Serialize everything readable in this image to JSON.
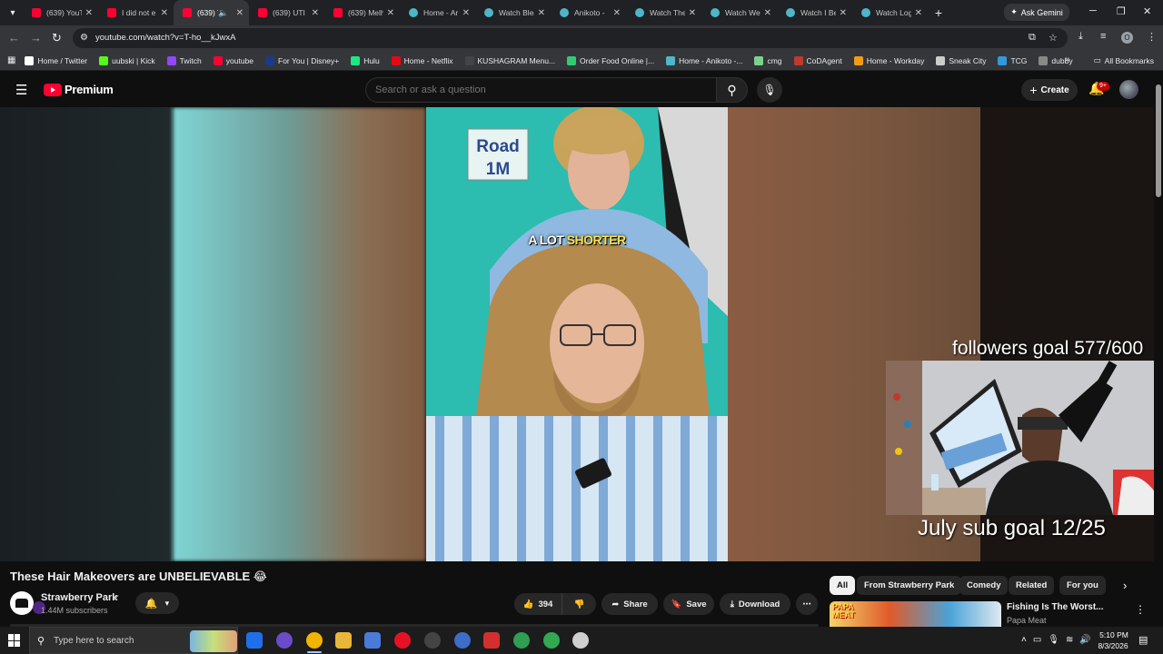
{
  "browser": {
    "tabs": [
      {
        "label": "(639) YouT",
        "icon": "youtube-icon",
        "active": false
      },
      {
        "label": "I did not e",
        "icon": "youtube-icon",
        "active": false
      },
      {
        "label": "(639) T",
        "icon": "youtube-icon",
        "active": true,
        "audio": true
      },
      {
        "label": "(639) UTI I",
        "icon": "youtube-icon",
        "active": false
      },
      {
        "label": "(639) Melh",
        "icon": "youtube-icon",
        "active": false
      },
      {
        "label": "Home - Ar",
        "icon": "globe-icon",
        "active": false
      },
      {
        "label": "Watch Blea",
        "icon": "globe-icon",
        "active": false
      },
      {
        "label": "Anikoto -",
        "icon": "globe-icon",
        "active": false
      },
      {
        "label": "Watch The",
        "icon": "globe-icon",
        "active": false
      },
      {
        "label": "Watch We",
        "icon": "globe-icon",
        "active": false
      },
      {
        "label": "Watch I Be",
        "icon": "globe-icon",
        "active": false
      },
      {
        "label": "Watch Log",
        "icon": "globe-icon",
        "active": false
      }
    ],
    "ask_gemini": "Ask Gemini",
    "url": "youtube.com/watch?v=T-ho__kJwxA",
    "bookmarks": [
      {
        "label": "Home / Twitter",
        "color": "#ffffff"
      },
      {
        "label": "uubski | Kick",
        "color": "#53fc18"
      },
      {
        "label": "Twitch",
        "color": "#9146ff"
      },
      {
        "label": "youtube",
        "color": "#ff0033"
      },
      {
        "label": "For You | Disney+",
        "color": "#1a3a8a"
      },
      {
        "label": "Hulu",
        "color": "#1ce783"
      },
      {
        "label": "Home - Netflix",
        "color": "#e50914"
      },
      {
        "label": "KUSHAGRAM Menu...",
        "color": "#444444"
      },
      {
        "label": "Order Food Online |...",
        "color": "#2ecc71"
      },
      {
        "label": "Home - Anikoto -...",
        "color": "#4fb5c9"
      },
      {
        "label": "cmg",
        "color": "#7bd389"
      },
      {
        "label": "CoDAgent",
        "color": "#c0392b"
      },
      {
        "label": "Home - Workday",
        "color": "#f39c12"
      },
      {
        "label": "Sneak City",
        "color": "#cccccc"
      },
      {
        "label": "TCG",
        "color": "#3498db"
      },
      {
        "label": "dubby",
        "color": "#888888"
      }
    ],
    "all_bookmarks": "All Bookmarks"
  },
  "youtube": {
    "brand": "Premium",
    "search_placeholder": "Search or ask a question",
    "create_label": "Create",
    "notification_badge": "9+",
    "subtitle_plain": "A LOT ",
    "subtitle_highlight": "SHORTER",
    "video_sign_text": "Road\n1M",
    "video_title": "These Hair Makeovers are UNBELIEVABLE 😂",
    "channel_name": "Strawberry Park",
    "subscribers": "1.44M subscribers",
    "like_count": "394",
    "share_label": "Share",
    "save_label": "Save",
    "download_label": "Download",
    "chips": [
      "All",
      "From Strawberry Park",
      "Comedy",
      "Related",
      "For you"
    ],
    "recommendation": {
      "title": "Fishing Is The Worst...",
      "channel": "Papa Meat",
      "thumb_label": "PAPA\nMEAT"
    }
  },
  "stream_overlay": {
    "followers_goal": "followers goal 577/600",
    "sub_goal": "July sub goal 12/25"
  },
  "taskbar": {
    "search_placeholder": "Type here to search",
    "time": "5:10 PM",
    "date": "8/3/2026",
    "accent": "#9ac7f5"
  }
}
